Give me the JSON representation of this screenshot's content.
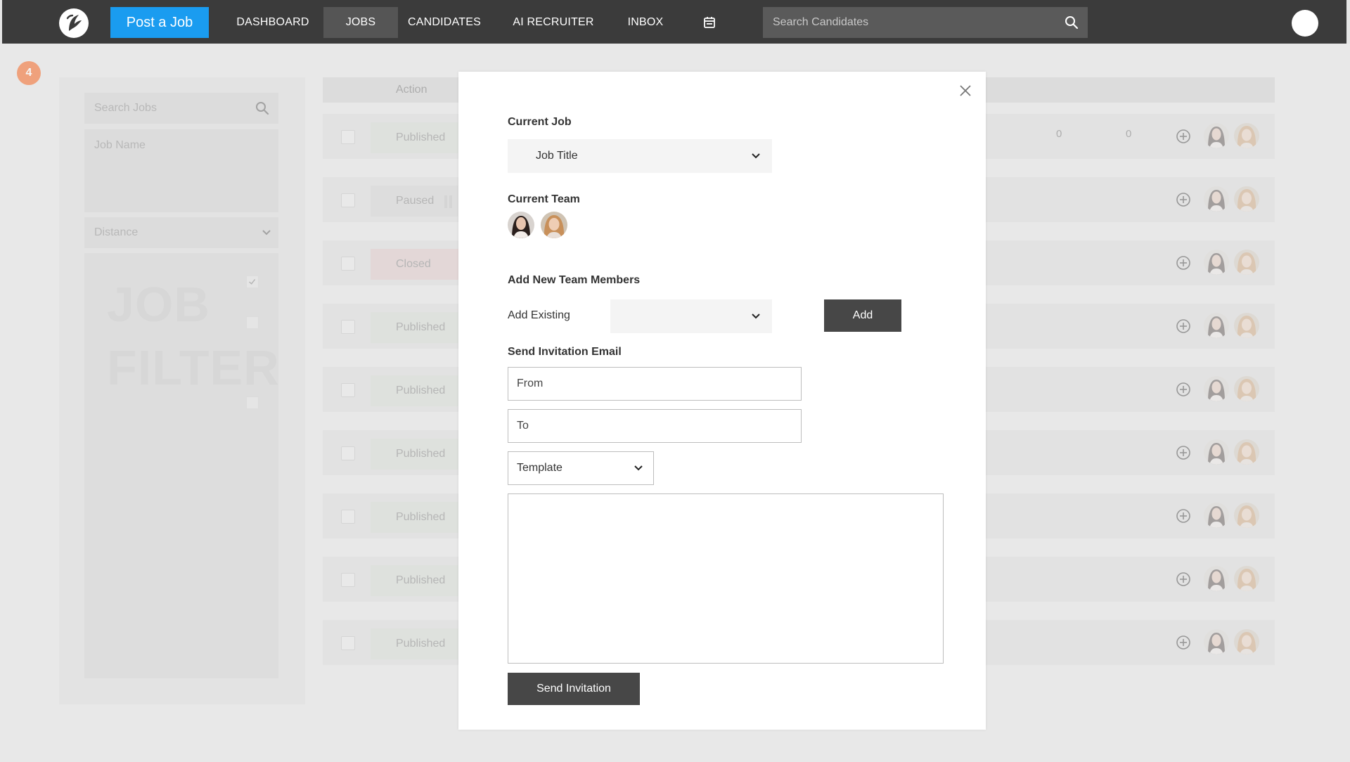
{
  "nav": {
    "post_job": "Post a Job",
    "items": [
      {
        "label": "DASHBOARD"
      },
      {
        "label": "JOBS"
      },
      {
        "label": "CANDIDATES"
      },
      {
        "label": "AI RECRUITER"
      },
      {
        "label": "INBOX"
      }
    ],
    "search_placeholder": "Search Candidates"
  },
  "badge": "4",
  "filters": {
    "search_jobs": "Search Jobs",
    "job_name": "Job Name",
    "distance": "Distance",
    "watermark_line1": "JOB",
    "watermark_line2": "FILTER"
  },
  "table": {
    "action_header": "Action",
    "rows": [
      {
        "status": "Published",
        "c1": "0",
        "c2": "0"
      },
      {
        "status": "Paused"
      },
      {
        "status": "Closed"
      },
      {
        "status": "Published"
      },
      {
        "status": "Published"
      },
      {
        "status": "Published"
      },
      {
        "status": "Published"
      },
      {
        "status": "Published"
      },
      {
        "status": "Published"
      }
    ]
  },
  "modal": {
    "current_job_label": "Current Job",
    "job_title": "Job Title",
    "current_team_label": "Current Team",
    "add_members_label": "Add New Team Members",
    "add_existing_label": "Add Existing",
    "add_button": "Add",
    "invite_label": "Send Invitation Email",
    "from_placeholder": "From",
    "to_placeholder": "To",
    "template": "Template",
    "send_button": "Send Invitation"
  },
  "colors": {
    "nav_bg": "#3b3b3b",
    "accent": "#1a9cf0",
    "badge": "#f26522",
    "button_dark": "#474747"
  }
}
